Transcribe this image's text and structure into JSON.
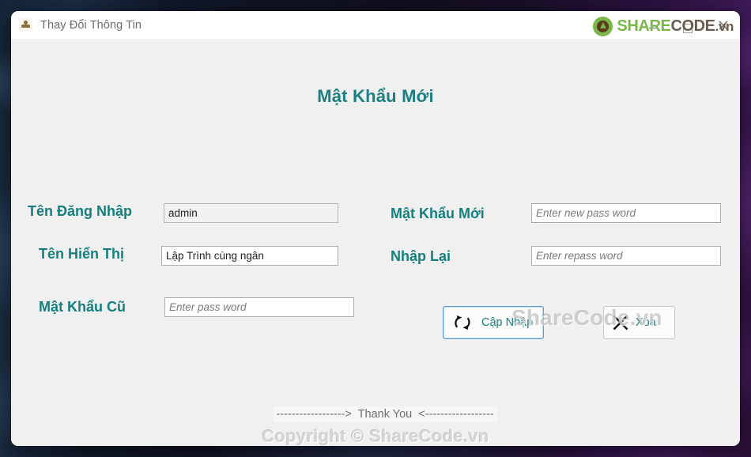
{
  "window": {
    "titlebar_title": "Thay Đổi Thông Tin",
    "app_icon": "user-icon",
    "controls": {
      "minimize": "minimize-icon",
      "maximize": "maximize-icon",
      "close": "close-icon"
    }
  },
  "branding": {
    "logo_share": "SHARE",
    "logo_code": "CODE",
    "logo_vn": ".vn",
    "watermark_center": "ShareCode.vn",
    "copyright": "Copyright © ShareCode.vn"
  },
  "form": {
    "title": "Mật Khẩu Mới",
    "fields": [
      {
        "id": "username",
        "label": "Tên Đăng Nhập",
        "value": "admin",
        "placeholder": ""
      },
      {
        "id": "display_name",
        "label": "Tên Hiển Thị",
        "value": "Lập Trình cùng ngân",
        "placeholder": ""
      },
      {
        "id": "old_password",
        "label": "Mật Khẩu Cũ",
        "value": "",
        "placeholder": "Enter pass word"
      },
      {
        "id": "new_password",
        "label": "Mật Khẩu Mới",
        "value": "",
        "placeholder": "Enter new pass word"
      },
      {
        "id": "retype_password",
        "label": "Nhập Lại",
        "value": "",
        "placeholder": "Enter repass word"
      }
    ],
    "buttons": [
      {
        "id": "update",
        "label": "Cập Nhập",
        "icon": "refresh-icon"
      },
      {
        "id": "delete",
        "label": "Xóa",
        "icon": "x-icon"
      }
    ]
  },
  "footer": {
    "thank_you": "------------------>  Thank You  <------------------"
  },
  "colors": {
    "label_teal": "#13807f",
    "title_teal": "#1a7f82",
    "focus_blue": "#5a9fd4",
    "logo_green": "#7ab648",
    "window_bg": "#f0f0f0"
  }
}
